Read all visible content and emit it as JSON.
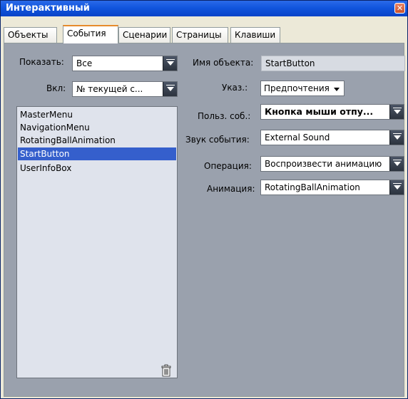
{
  "window": {
    "title": "Интерактивный",
    "close_glyph": "✕"
  },
  "tabs": [
    {
      "label": "Объекты"
    },
    {
      "label": "События",
      "active": true
    },
    {
      "label": "Сценарии"
    },
    {
      "label": "Страницы"
    },
    {
      "label": "Клавиши"
    }
  ],
  "left": {
    "show_label": "Показать:",
    "show_value": "Все",
    "on_label": "Вкл:",
    "on_value": "№ текущей с...",
    "objects": [
      "MasterMenu",
      "NavigationMenu",
      "RotatingBallAnimation",
      "StartButton",
      "UserInfoBox"
    ],
    "selected_index": 3
  },
  "right": {
    "object_name_label": "Имя объекта:",
    "object_name_value": "StartButton",
    "pointer_label": "Указ.:",
    "pointer_value": "Предпочтения",
    "user_event_label": "Польз. соб.:",
    "user_event_value": "Кнопка мыши отпу...",
    "event_sound_label": "Звук события:",
    "event_sound_value": "External Sound",
    "operation_label": "Операция:",
    "operation_value": "Воспроизвести анимацию",
    "animation_label": "Анимация:",
    "animation_value": "RotatingBallAnimation"
  },
  "colors": {
    "panel": "#9aa1ad",
    "selection": "#355fcc",
    "titlebar": "#0843c8"
  },
  "icons": {
    "delete": "trash-icon",
    "close": "close-icon"
  }
}
